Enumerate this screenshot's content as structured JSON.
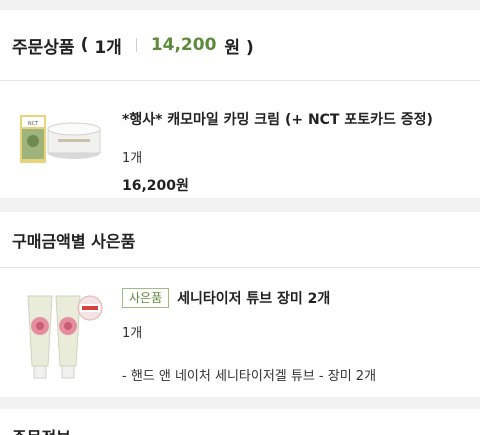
{
  "order_items": {
    "title": "주문상품",
    "paren_open": "(",
    "count": "1개",
    "total_price": "14,200",
    "currency_close": "원 )"
  },
  "product": {
    "name": "*행사* 캐모마일 카밍 크림 (+ NCT 포토카드 증정)",
    "quantity": "1개",
    "price": "16,200원",
    "thumbnail_icon": "cream-jar-with-photocard-image"
  },
  "gift_section": {
    "title": "구매금액별 사은품"
  },
  "gift": {
    "badge": "사은품",
    "name": "세니타이저 튜브 장미 2개",
    "quantity": "1개",
    "detail": "- 핸드 앤 네이처 세니타이저겔 튜브 - 장미 2개",
    "thumbnail_icon": "rose-sanitizer-tubes-image"
  },
  "order_info": {
    "title": "주문정보"
  },
  "colors": {
    "accent_green": "#5d8a3a",
    "badge_border": "#9cbf82",
    "background": "#f2f2f2"
  }
}
